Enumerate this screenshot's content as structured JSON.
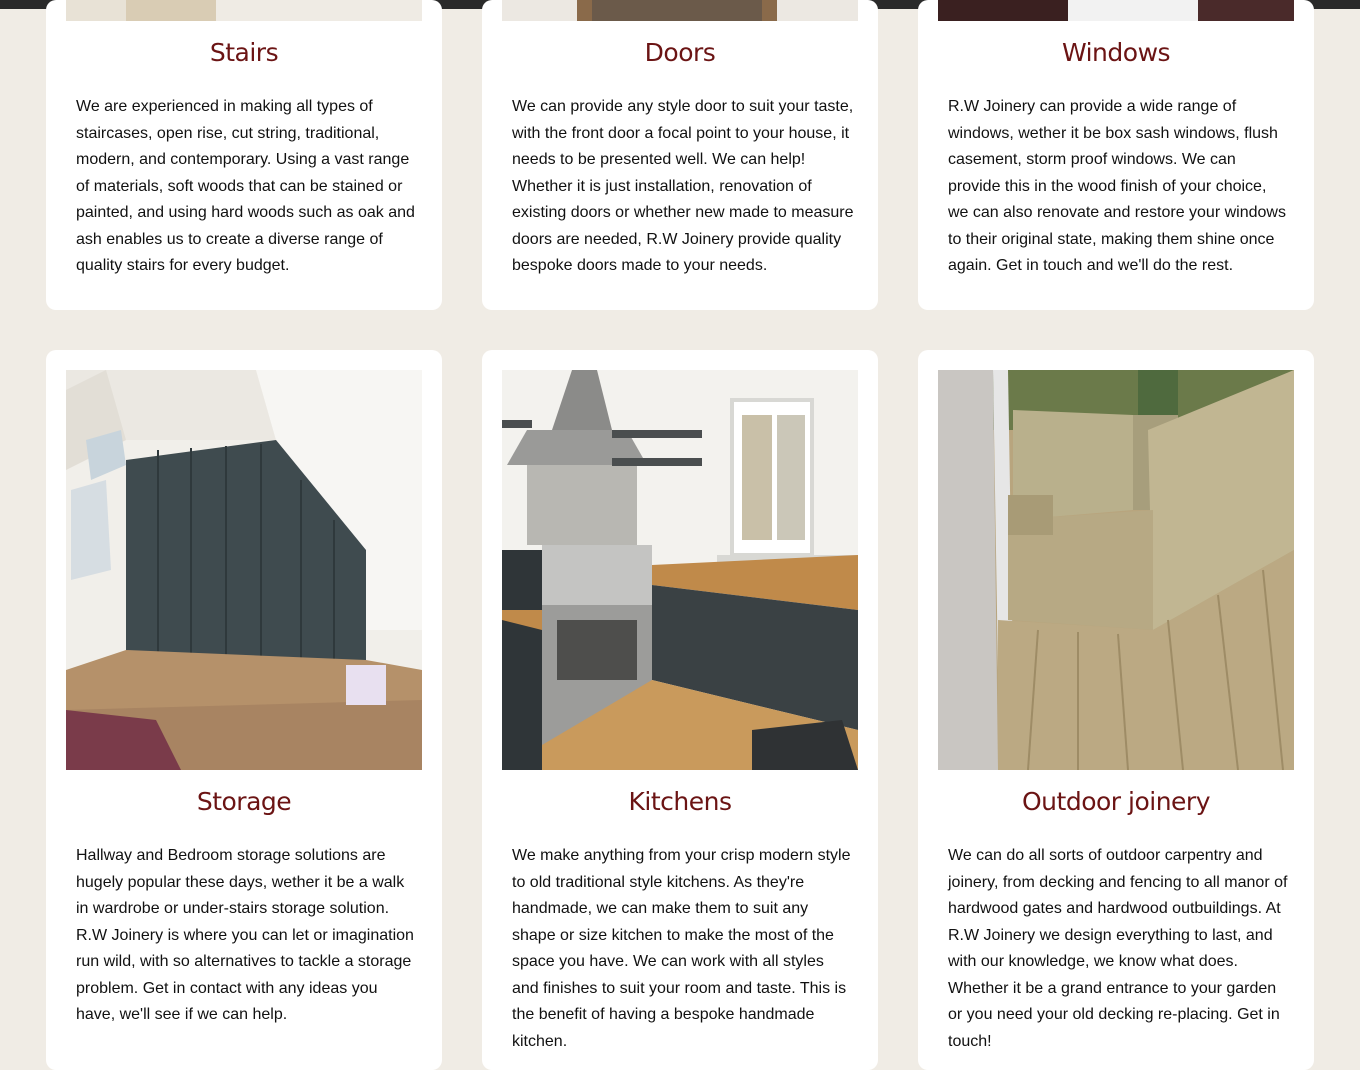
{
  "services": [
    {
      "title": "Stairs",
      "text": "We are experienced in making all types of staircases, open rise, cut string, traditional, modern, and contemporary. Using a vast range of materials, soft woods that can be stained or painted, and using hard woods such as oak and ash enables us to create a diverse range of quality stairs for every budget."
    },
    {
      "title": "Doors",
      "text": "We can provide any style door to suit your taste, with the front door a focal point to your house, it needs to be presented well. We can help! Whether it is just installation, renovation of existing doors or whether new made to measure doors are needed, R.W Joinery provide quality bespoke doors made to your needs."
    },
    {
      "title": "Windows",
      "text": "R.W Joinery can provide a wide range of windows, wether it be box sash windows, flush casement, storm proof windows. We can provide this in the wood finish of your choice, we can also renovate and restore your windows to their original state, making them shine once again. Get in touch and we'll do the rest."
    },
    {
      "title": "Storage",
      "text": "Hallway and Bedroom storage solutions are hugely popular these days, wether it be a walk in wardrobe or under-stairs storage solution. R.W Joinery is where you can let or imagination run wild, with so alternatives to tackle a storage problem. Get in contact with any ideas you have, we'll see if we can help."
    },
    {
      "title": "Kitchens",
      "text": "We make anything from your crisp modern style to old traditional style kitchens. As they're handmade, we can make them to suit any shape or size kitchen to make the most of the space you have. We can work with all styles and finishes to suit your room and taste. This is the benefit of having a bespoke handmade kitchen."
    },
    {
      "title": "Outdoor joinery",
      "text": "We can do all sorts of outdoor carpentry and joinery, from decking and fencing to all manor of hardwood gates and hardwood outbuildings. At R.W Joinery we design everything to last, and with our knowledge, we know what does. Whether it be a grand entrance to your garden or you need your old decking re-placing. Get in touch!"
    }
  ],
  "colors": {
    "page_bg": "#f0ece5",
    "card_bg": "#ffffff",
    "heading": "#6b1414",
    "body_text": "#111111"
  }
}
